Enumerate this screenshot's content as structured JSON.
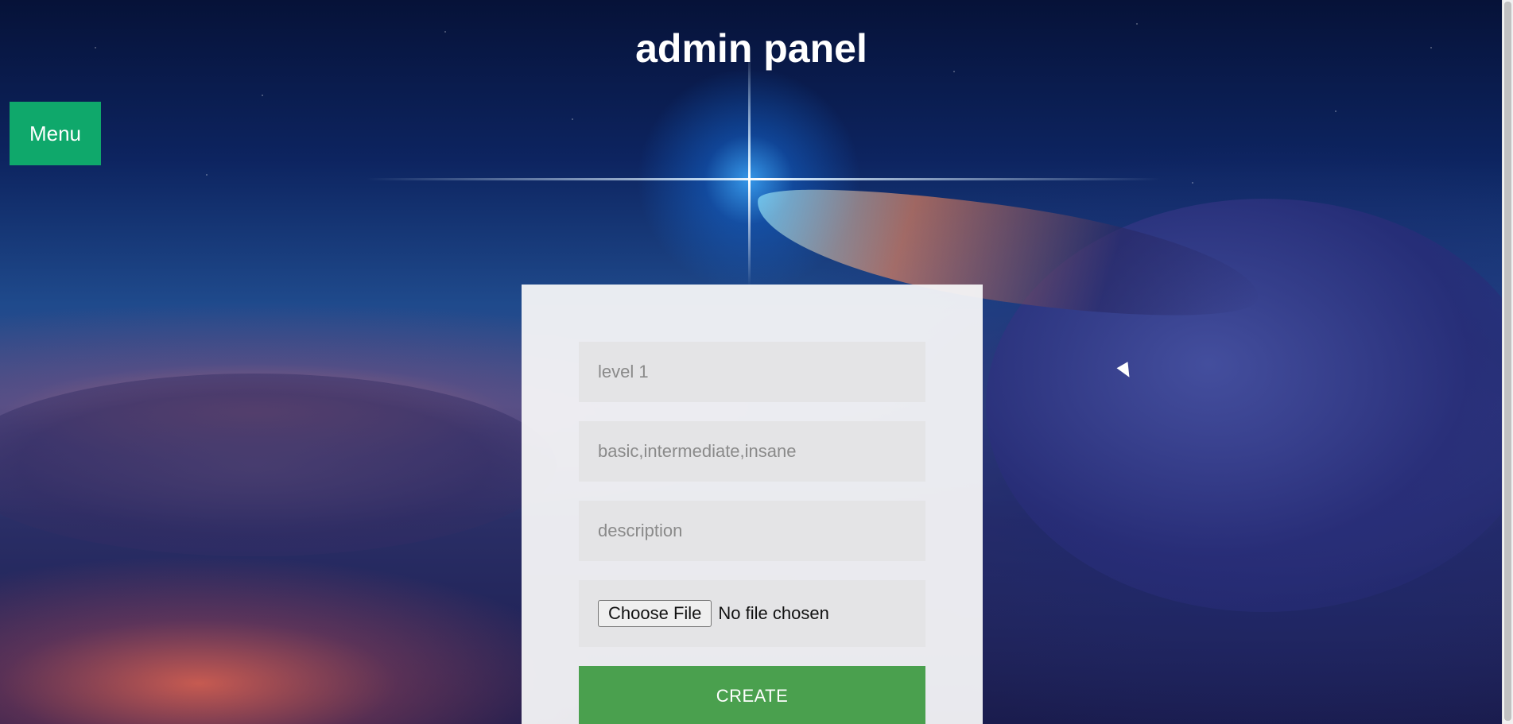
{
  "header": {
    "title": "admin panel"
  },
  "nav": {
    "menu_label": "Menu"
  },
  "form": {
    "level_placeholder": "level 1",
    "difficulty_placeholder": "basic,intermediate,insane",
    "description_placeholder": "description",
    "file_button_label": "Choose File",
    "file_status": "No file chosen",
    "create_label": "CREATE"
  },
  "colors": {
    "menu_button": "#0fa86b",
    "create_button": "#4aa04e",
    "panel": "#f6f6f8",
    "field": "#e4e4e6"
  }
}
